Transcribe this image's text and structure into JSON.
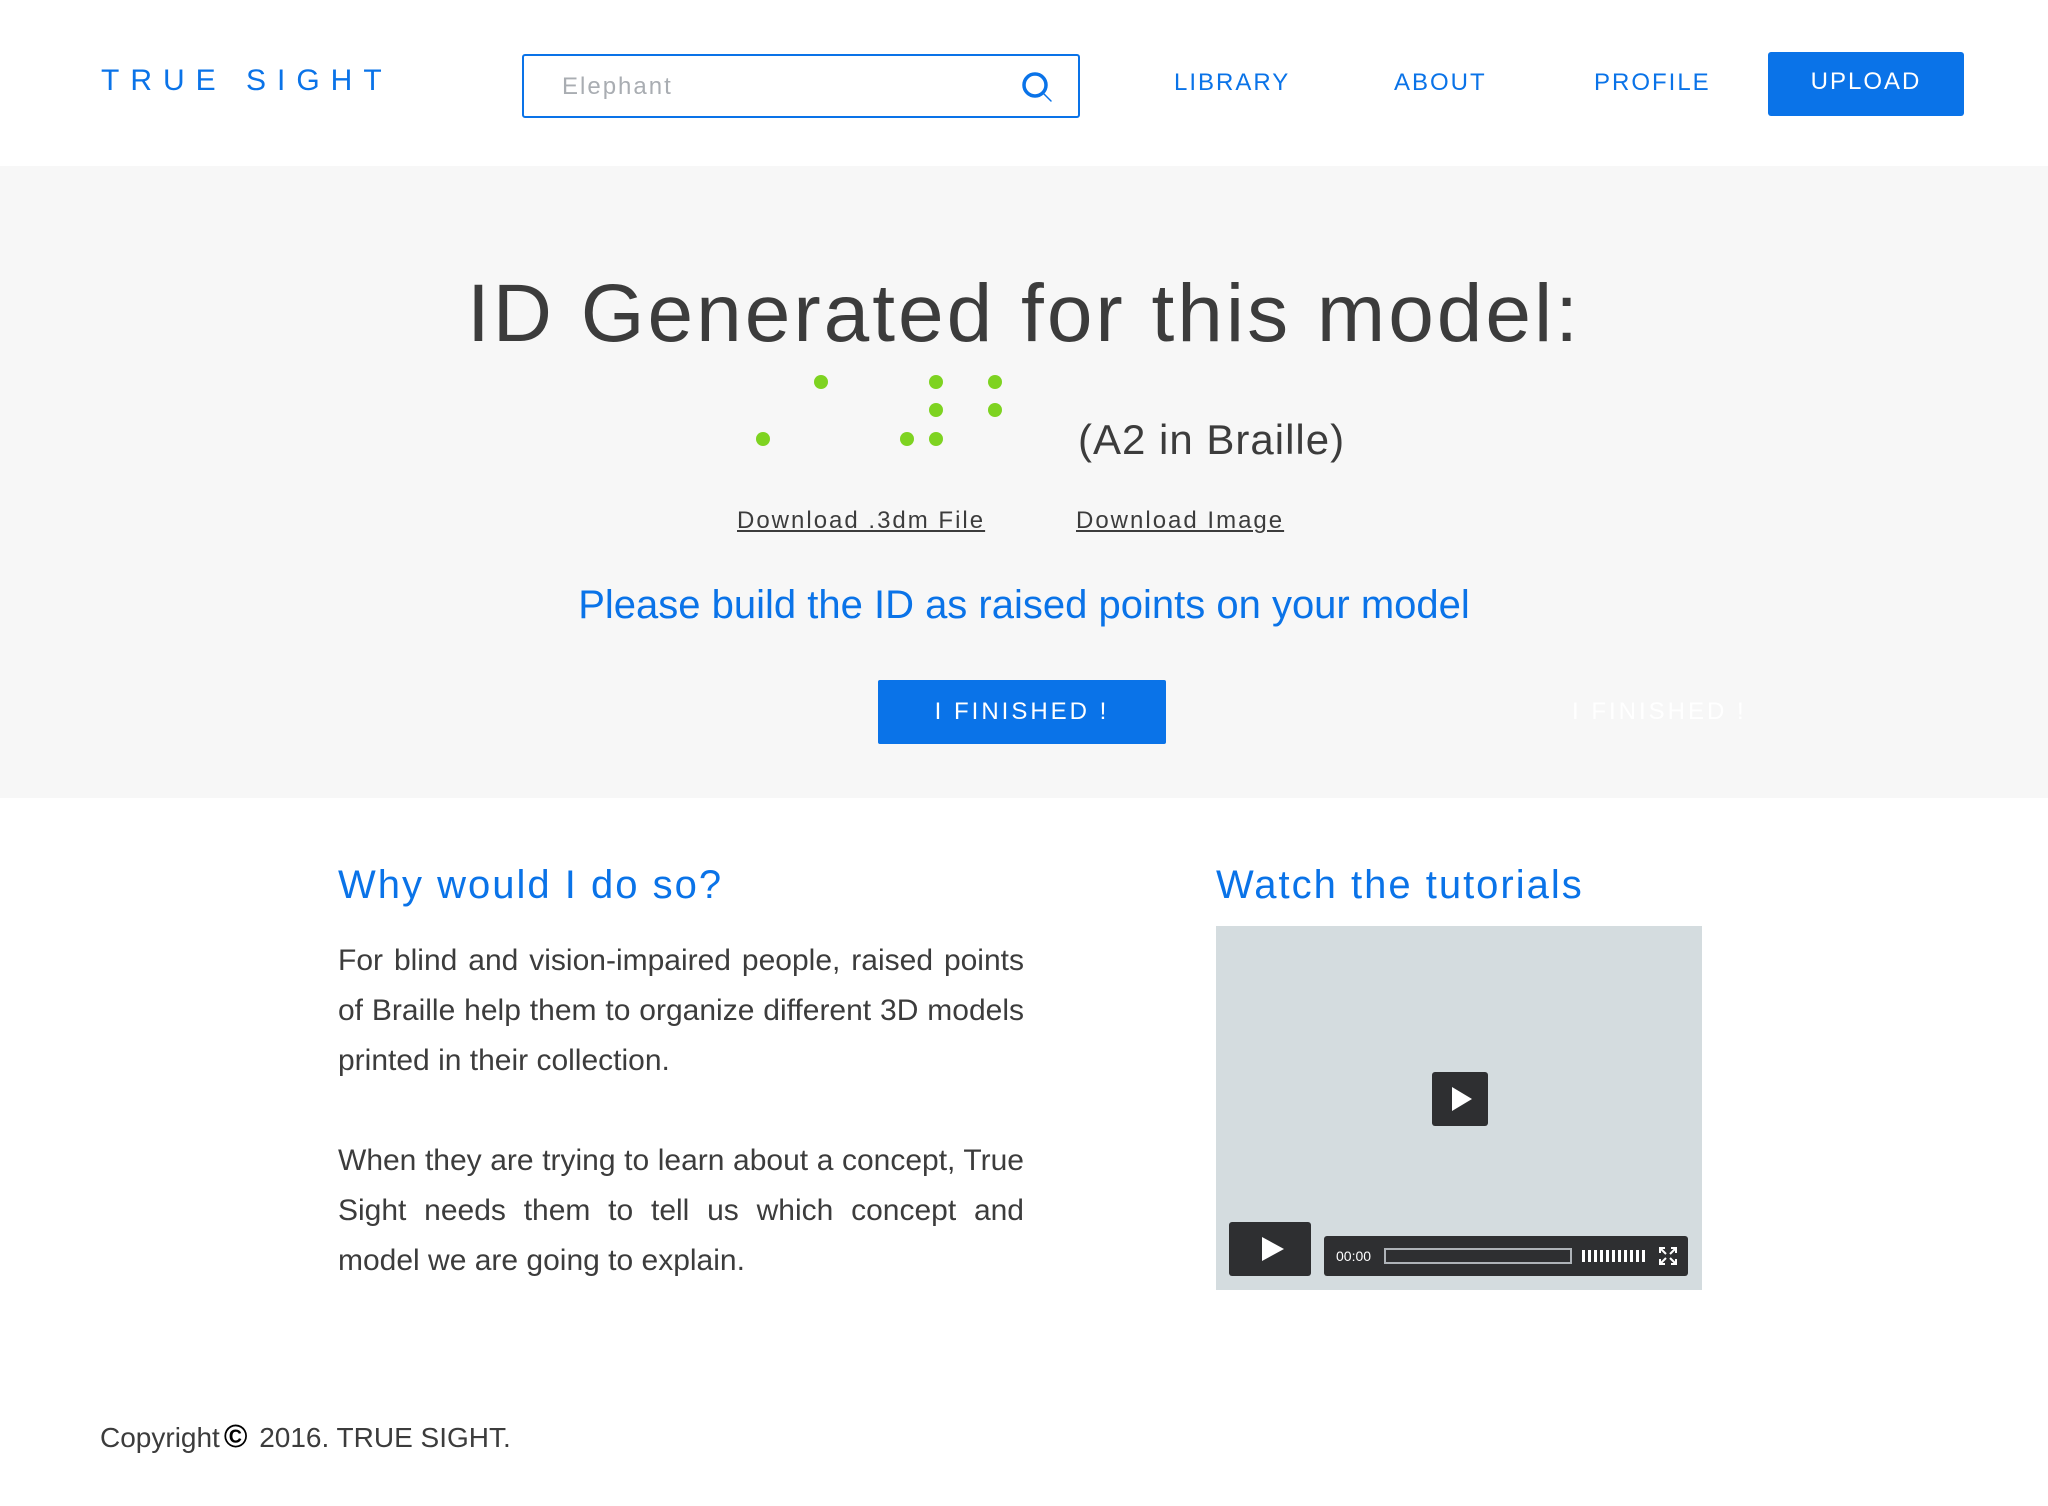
{
  "header": {
    "logo": "TRUE SIGHT",
    "search": {
      "placeholder": "Elephant",
      "icon": "search-icon"
    },
    "nav": {
      "library": "LIBRARY",
      "about": "ABOUT",
      "profile": "PROFILE"
    },
    "upload_label": "UPLOAD"
  },
  "hero": {
    "title": "ID Generated for this model:",
    "braille_caption": "(A2 in Braille)",
    "download_3dm": "Download .3dm File",
    "download_image": "Download Image",
    "instruction": "Please build the ID as raised points on your model",
    "finished_label": "I FINISHED !",
    "finished_ghost_label": "I FINISHED !"
  },
  "content": {
    "why_heading": "Why would I do so?",
    "why_paragraph_1": "For blind and vision-impaired people, raised points of Braille help them to organize different 3D models printed in their collection.",
    "why_paragraph_2": "When they are trying to learn about a concept, True Sight needs them to tell us which concept and model we are going to explain.",
    "tutorials_heading": "Watch the tutorials",
    "video": {
      "time": "00:00",
      "progress": 0
    }
  },
  "footer": {
    "copyright_prefix": "Copyright",
    "copyright_symbol": "©",
    "copyright_suffix": " 2016. TRUE SIGHT."
  },
  "colors": {
    "accent": "#0a73e8",
    "braille_dot": "#7ed321",
    "hero_bg": "#f7f7f7",
    "text": "#3c3c3c",
    "video_bg": "#d4dcdf",
    "video_controls": "#2e2f31"
  }
}
